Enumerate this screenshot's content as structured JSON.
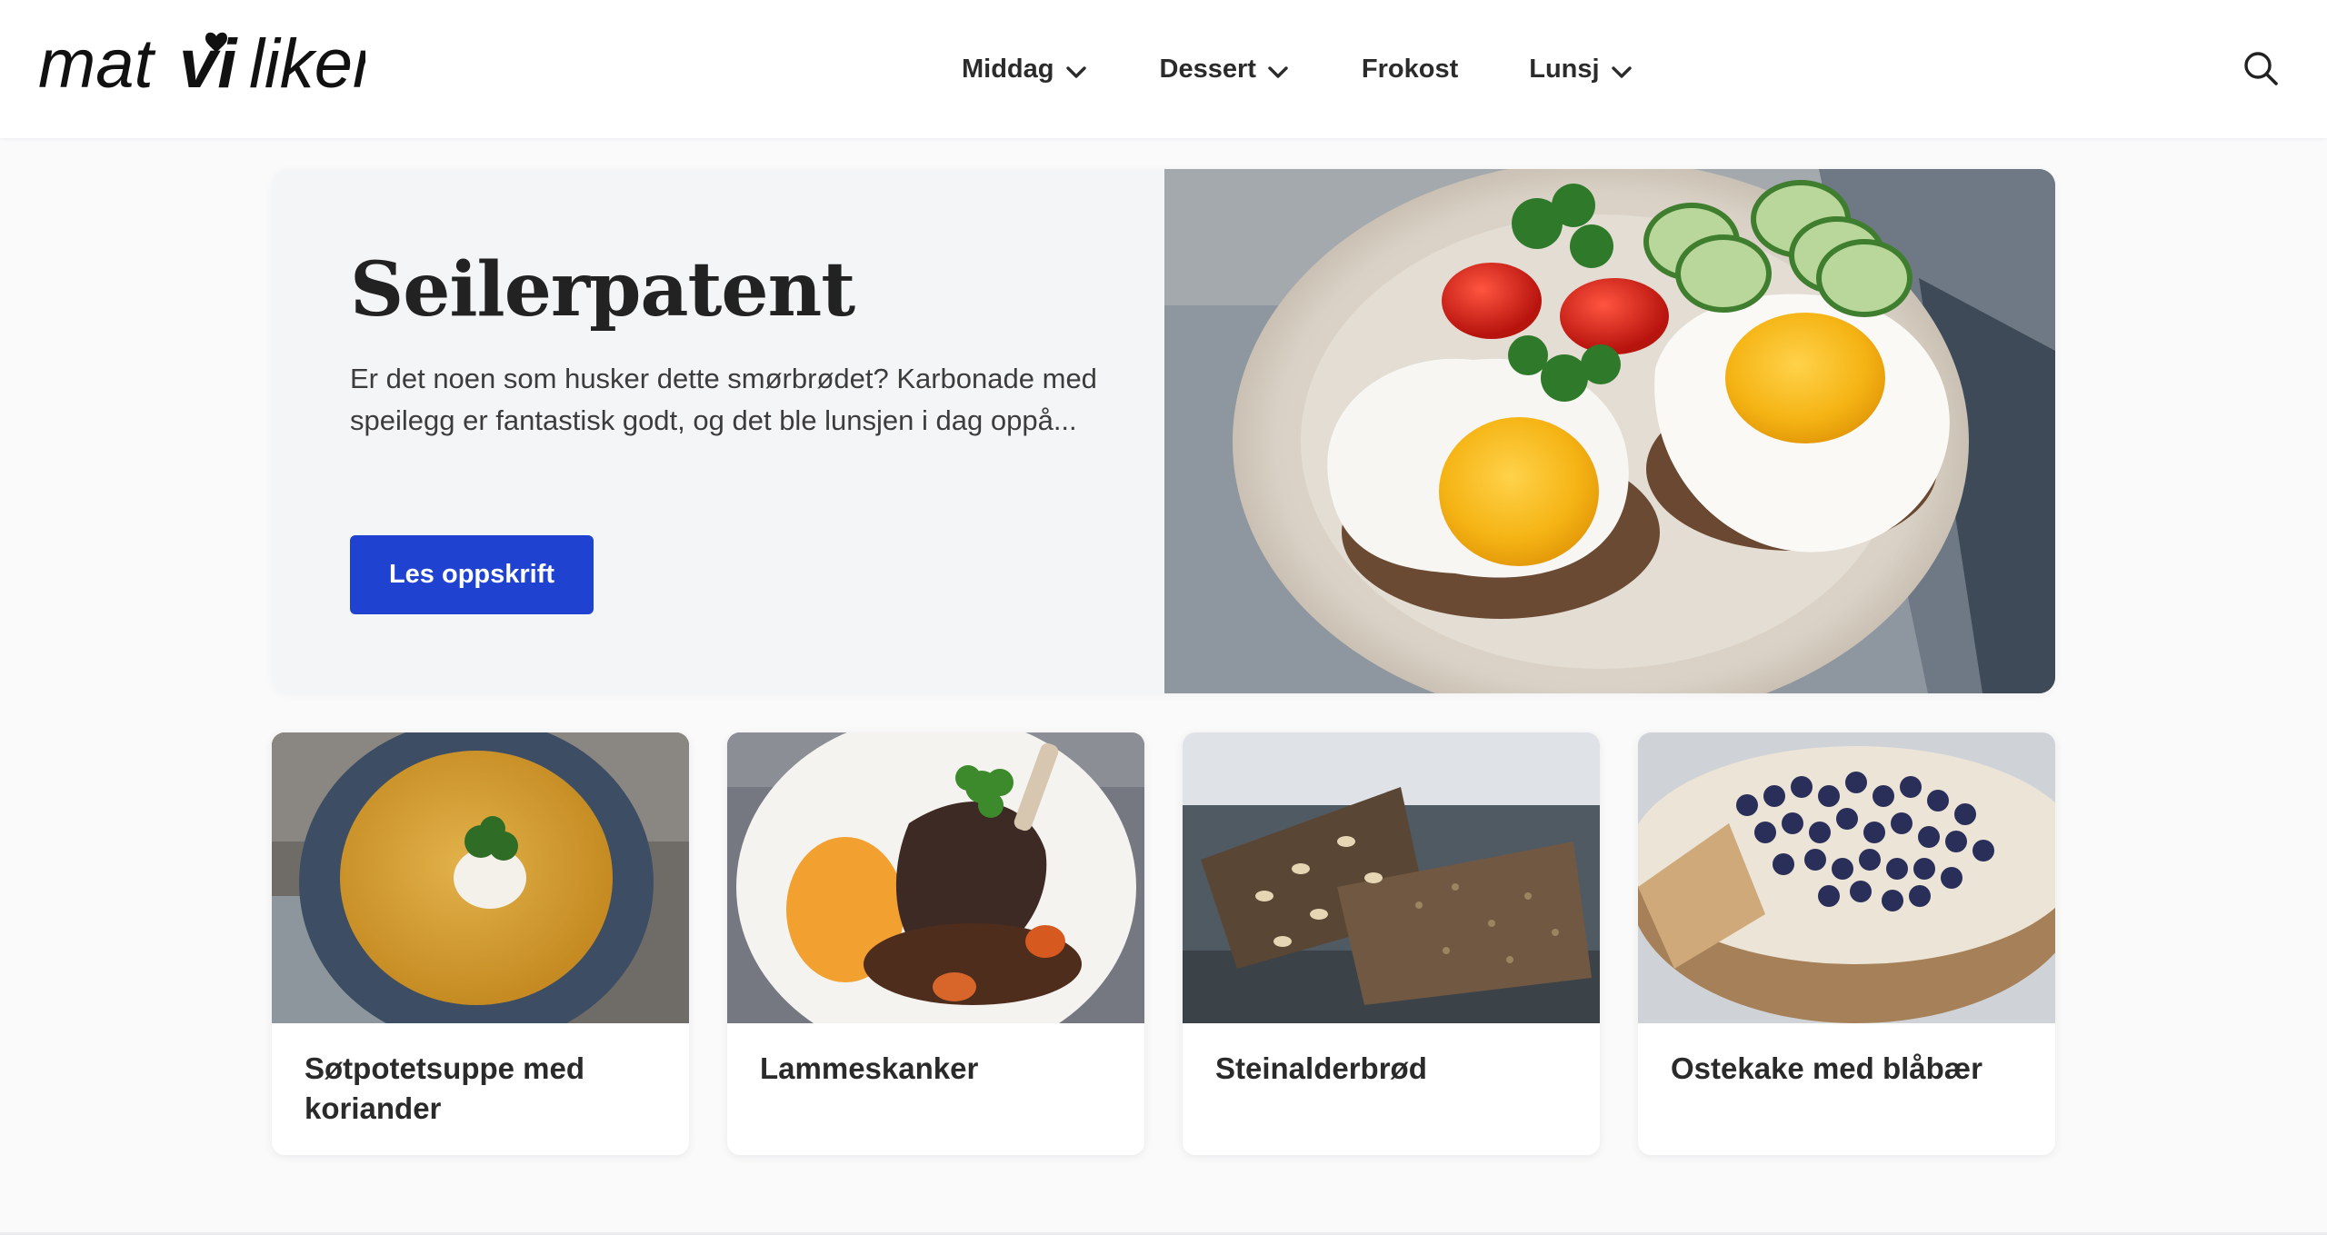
{
  "site": {
    "logo_text_mat": "mat",
    "logo_text_vi": "vi",
    "logo_text_liker": "liker"
  },
  "nav": {
    "items": [
      {
        "label": "Middag",
        "has_dropdown": true
      },
      {
        "label": "Dessert",
        "has_dropdown": true
      },
      {
        "label": "Frokost",
        "has_dropdown": false
      },
      {
        "label": "Lunsj",
        "has_dropdown": true
      }
    ],
    "search_icon": "search-icon"
  },
  "hero": {
    "title": "Seilerpatent",
    "description": "Er det noen som husker dette smørbrødet? Karbonade med speilegg er fantastisk godt, og det ble lunsjen i dag oppå...",
    "button_label": "Les oppskrift",
    "accent_color": "#1f43d0"
  },
  "cards": [
    {
      "title": "Søtpotetsuppe med koriander"
    },
    {
      "title": "Lammeskanker"
    },
    {
      "title": "Steinalderbrød"
    },
    {
      "title": "Ostekake med blåbær"
    }
  ]
}
